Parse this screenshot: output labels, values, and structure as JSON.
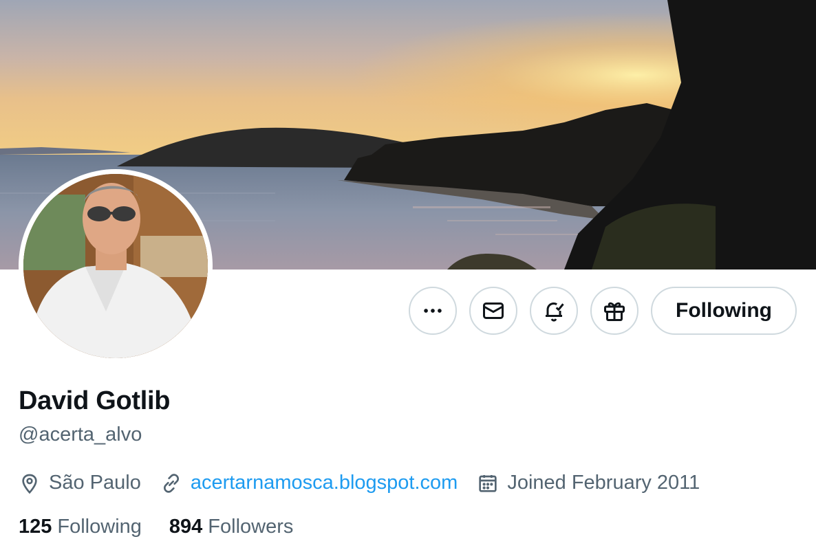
{
  "profile": {
    "display_name": "David Gotlib",
    "handle": "@acerta_alvo",
    "location": "São Paulo",
    "website": "acertarnamosca.blogspot.com",
    "joined": "Joined February 2011",
    "following_count": "125",
    "following_label": "Following",
    "followers_count": "894",
    "followers_label": "Followers"
  },
  "actions": {
    "follow_button_label": "Following",
    "more_icon": "more-horizontal-icon",
    "message_icon": "envelope-icon",
    "notify_icon": "bell-check-icon",
    "gift_icon": "gift-icon"
  },
  "icons": {
    "location": "map-pin-icon",
    "website": "link-icon",
    "joined": "calendar-icon"
  },
  "colors": {
    "link": "#1d9bf0",
    "secondary_text": "#536471",
    "primary_text": "#0f1419",
    "button_border": "#cfd9de"
  }
}
